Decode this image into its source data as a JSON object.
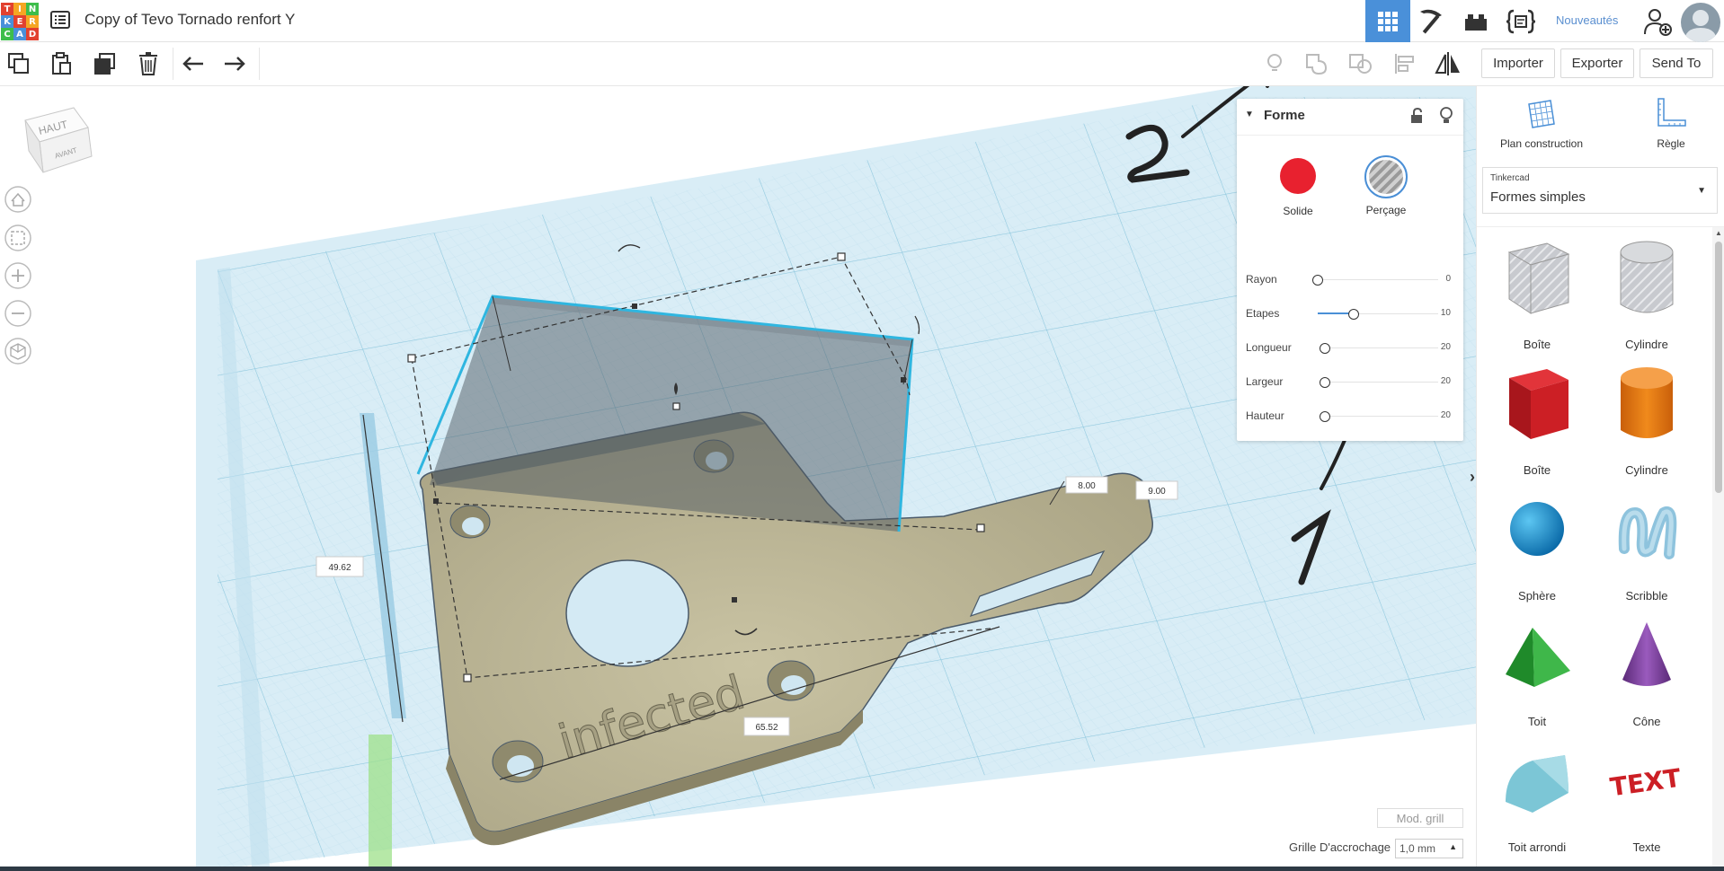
{
  "header": {
    "logo_letters": [
      "T",
      "I",
      "N",
      "K",
      "E",
      "R",
      "C",
      "A",
      "D"
    ],
    "logo_colors": [
      "#e2412f",
      "#f5a623",
      "#3dbd4b",
      "#4a90d9",
      "#e2412f",
      "#f5a623",
      "#3dbd4b",
      "#4a90d9",
      "#e2412f"
    ],
    "title": "Copy of Tevo Tornado renfort Y",
    "nouveautes": "Nouveautés"
  },
  "toolbar": {
    "import_label": "Importer",
    "export_label": "Exporter",
    "sendto_label": "Send To"
  },
  "viewcube": {
    "top": "HAUT",
    "front": "AVANT"
  },
  "scene": {
    "dimensions": {
      "height": "49.62",
      "length": "65.52",
      "width_a": "8.00",
      "width_b": "9.00"
    },
    "engraved_text": "infected",
    "annotation_1": "1",
    "annotation_2": "2"
  },
  "shape_panel": {
    "title": "Forme",
    "solid_label": "Solide",
    "hole_label": "Perçage",
    "params": [
      {
        "label": "Rayon",
        "value": "0"
      },
      {
        "label": "Etapes",
        "value": "10"
      },
      {
        "label": "Longueur",
        "value": "20"
      },
      {
        "label": "Largeur",
        "value": "20"
      },
      {
        "label": "Hauteur",
        "value": "20"
      }
    ]
  },
  "sidebar": {
    "workplane_label": "Plan construction",
    "ruler_label": "Règle",
    "library_source": "Tinkercad",
    "library_name": "Formes simples",
    "shapes": [
      {
        "label": "Boîte"
      },
      {
        "label": "Cylindre"
      },
      {
        "label": "Boîte"
      },
      {
        "label": "Cylindre"
      },
      {
        "label": "Sphère"
      },
      {
        "label": "Scribble"
      },
      {
        "label": "Toit"
      },
      {
        "label": "Cône"
      },
      {
        "label": "Toit arrondi"
      },
      {
        "label": "Texte"
      }
    ],
    "text_shape_glyph": "TEXT"
  },
  "footer": {
    "grid_edit": "Mod. grill",
    "snap_label": "Grille D'accrochage",
    "snap_value": "1,0 mm"
  }
}
